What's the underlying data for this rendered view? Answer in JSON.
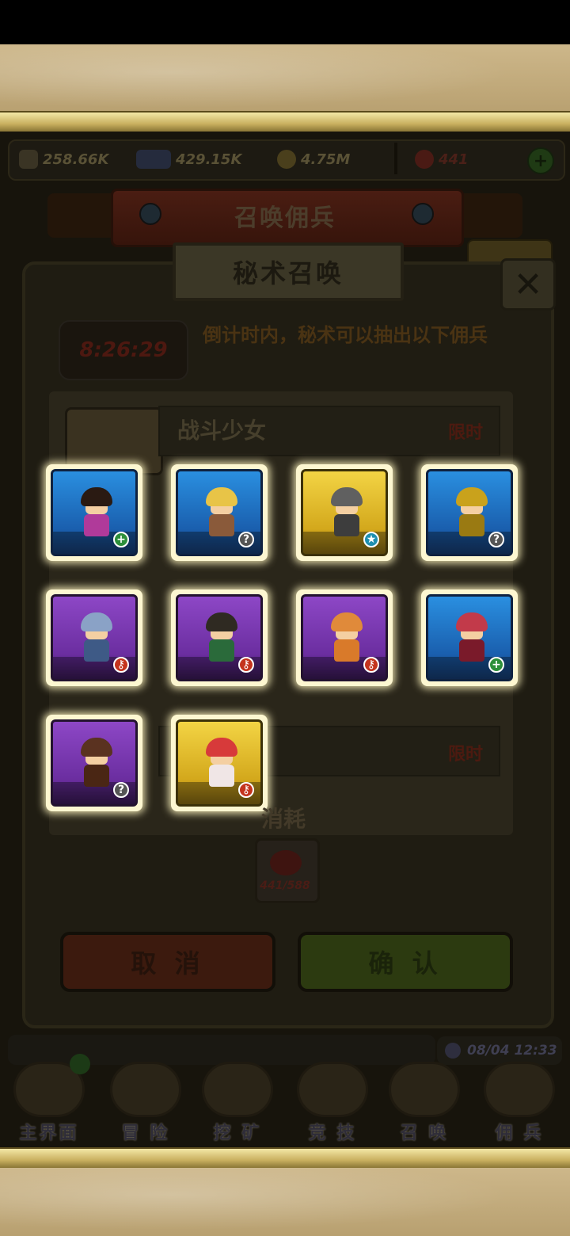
{
  "resources": [
    {
      "name": "attack",
      "icon": "sword-icon",
      "value": "258.66K"
    },
    {
      "name": "exp",
      "icon": "exp-icon",
      "value": "429.15K"
    },
    {
      "name": "gold",
      "icon": "coin-icon",
      "value": "4.75M"
    },
    {
      "name": "gems",
      "icon": "gem-icon",
      "value": "441"
    }
  ],
  "header": {
    "title": "召唤佣兵"
  },
  "dialog": {
    "subtitle": "秘术召唤",
    "close_glyph": "✕",
    "timer": "8:26:29",
    "timer_note": "倒计时内，秘术可以抽出以下佣兵",
    "rows": [
      {
        "title": "战斗少女",
        "tag": "限时"
      },
      {
        "title": "",
        "tag": "限时"
      }
    ],
    "cost_label": "消耗",
    "cost_amount": "441/588",
    "cancel_label": "取 消",
    "confirm_label": "确 认"
  },
  "heroes": [
    {
      "rarity": "blue",
      "hair": "#2a1a12",
      "body": "#b03a9a",
      "badge": "plus"
    },
    {
      "rarity": "blue",
      "hair": "#e8c447",
      "body": "#8a5a3a",
      "badge": "question"
    },
    {
      "rarity": "gold",
      "hair": "#606060",
      "body": "#3d3d3d",
      "badge": "star"
    },
    {
      "rarity": "blue",
      "hair": "#c9a21c",
      "body": "#9a7a12",
      "badge": "question"
    },
    {
      "rarity": "purple",
      "hair": "#8aa2c6",
      "body": "#3e5a86",
      "badge": "key"
    },
    {
      "rarity": "purple",
      "hair": "#2f2a22",
      "body": "#2a6a3a",
      "badge": "key"
    },
    {
      "rarity": "purple",
      "hair": "#e08a3a",
      "body": "#d97a2a",
      "badge": "key"
    },
    {
      "rarity": "blue",
      "hair": "#c23a4a",
      "body": "#7a1a2a",
      "badge": "plus"
    },
    {
      "rarity": "purple",
      "hair": "#5a3220",
      "body": "#4a2614",
      "badge": "question"
    },
    {
      "rarity": "gold",
      "hair": "#d73a3a",
      "body": "#f0e6e6",
      "badge": "key"
    }
  ],
  "status": {
    "datetime": "08/04 12:33"
  },
  "nav": [
    {
      "label": "主界面",
      "icon": "map-scroll-icon"
    },
    {
      "label": "冒 险",
      "icon": "island-icon"
    },
    {
      "label": "挖 矿",
      "icon": "pickaxe-icon"
    },
    {
      "label": "竞 技",
      "icon": "crossed-swords-icon"
    },
    {
      "label": "召 唤",
      "icon": "summon-scroll-icon"
    },
    {
      "label": "佣 兵",
      "icon": "tent-icon"
    }
  ]
}
